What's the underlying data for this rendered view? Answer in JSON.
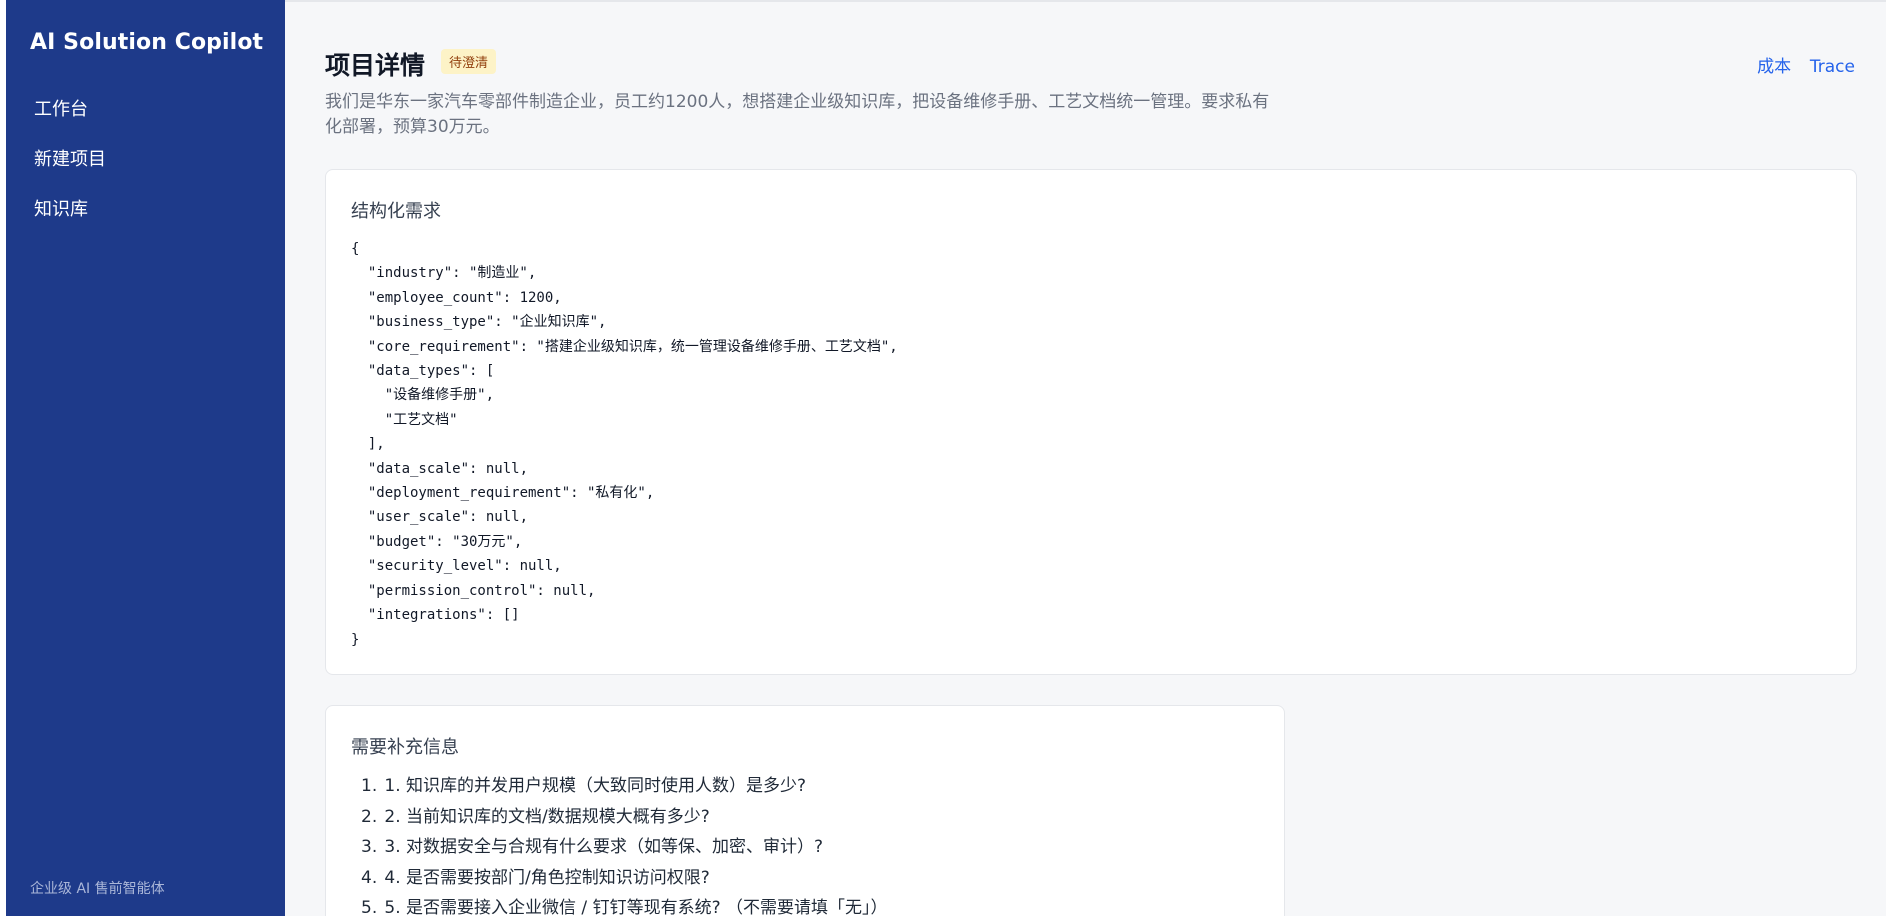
{
  "sidebar": {
    "brand": "AI Solution Copilot",
    "items": [
      {
        "label": "工作台"
      },
      {
        "label": "新建项目"
      },
      {
        "label": "知识库"
      }
    ],
    "footer": "企业级 AI 售前智能体"
  },
  "header": {
    "title": "项目详情",
    "status": "待澄清",
    "links": [
      "成本",
      "Trace"
    ],
    "description": "我们是华东一家汽车零部件制造企业，员工约1200人，想搭建企业级知识库，把设备维修手册、工艺文档统一管理。要求私有化部署，预算30万元。"
  },
  "requirements_card": {
    "title": "结构化需求",
    "json_text": "{\n  \"industry\": \"制造业\",\n  \"employee_count\": 1200,\n  \"business_type\": \"企业知识库\",\n  \"core_requirement\": \"搭建企业级知识库，统一管理设备维修手册、工艺文档\",\n  \"data_types\": [\n    \"设备维修手册\",\n    \"工艺文档\"\n  ],\n  \"data_scale\": null,\n  \"deployment_requirement\": \"私有化\",\n  \"user_scale\": null,\n  \"budget\": \"30万元\",\n  \"security_level\": null,\n  \"permission_control\": null,\n  \"integrations\": []\n}"
  },
  "more_info_card": {
    "title": "需要补充信息",
    "questions": [
      {
        "num": "1.",
        "text": "1. 知识库的并发用户规模（大致同时使用人数）是多少?"
      },
      {
        "num": "2.",
        "text": "2. 当前知识库的文档/数据规模大概有多少?"
      },
      {
        "num": "3.",
        "text": "3. 对数据安全与合规有什么要求（如等保、加密、审计）?"
      },
      {
        "num": "4.",
        "text": "4. 是否需要按部门/角色控制知识访问权限?"
      },
      {
        "num": "5.",
        "text": "5. 是否需要接入企业微信 / 钉钉等现有系统? （不需要请填「无」）"
      }
    ]
  }
}
